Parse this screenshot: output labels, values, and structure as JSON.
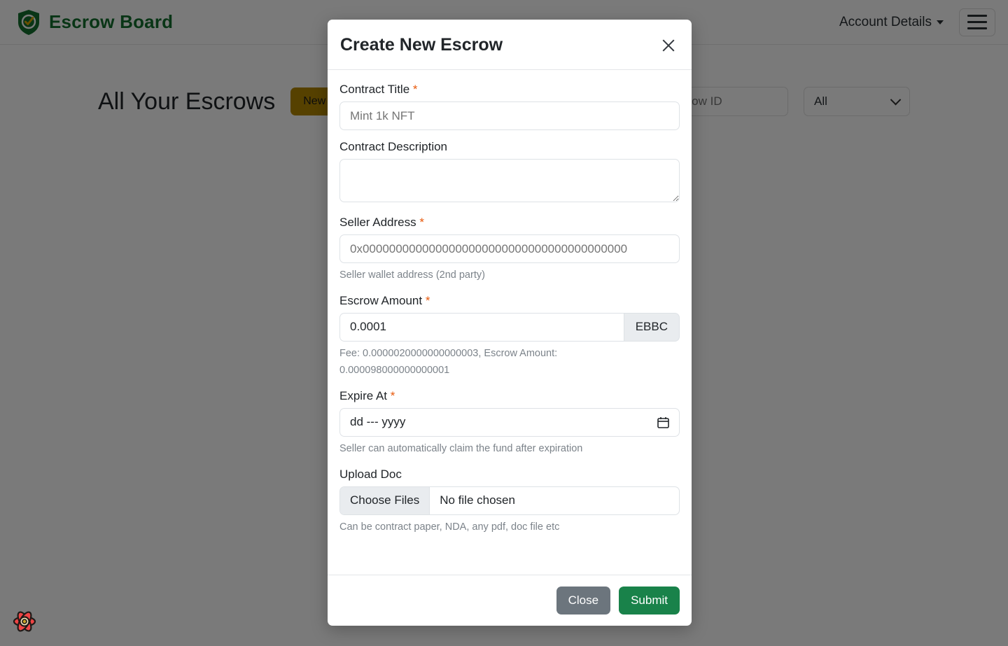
{
  "navbar": {
    "brand": "Escrow Board",
    "brand_icon": "shield-check-icon",
    "brand_color": "#14702f",
    "account_label": "Account Details",
    "menu_icon": "hamburger-menu-icon"
  },
  "toolbar": {
    "page_title": "All Your Escrows",
    "new_escrow_label": "New Escrow",
    "new_escrow_color": "#b58900",
    "search_placeholder": "Search By Escrow ID",
    "filter_value": "All",
    "filter_icon": "chevron-down-icon"
  },
  "modal": {
    "title": "Create New Escrow",
    "close_icon": "close-icon",
    "fields": {
      "contract_title": {
        "label": "Contract Title",
        "required_mark": "*",
        "placeholder": "Mint 1k NFT",
        "value": ""
      },
      "contract_description": {
        "label": "Contract Description",
        "placeholder": "",
        "value": ""
      },
      "seller_address": {
        "label": "Seller Address",
        "required_mark": "*",
        "placeholder": "0x0000000000000000000000000000000000000000",
        "value": "",
        "help": "Seller wallet address (2nd party)"
      },
      "escrow_amount": {
        "label": "Escrow Amount",
        "required_mark": "*",
        "value": "0.0001",
        "currency": "EBBC",
        "help_line1": "Fee: 0.0000020000000000003, Escrow Amount:",
        "help_line2": "0.000098000000000001"
      },
      "expire_at": {
        "label": "Expire At",
        "required_mark": "*",
        "value": "dd --- yyyy",
        "calendar_icon": "calendar-icon",
        "help": "Seller can automatically claim the fund after expiration"
      },
      "upload_doc": {
        "label": "Upload Doc",
        "choose_button": "Choose Files",
        "file_status": "No file chosen",
        "help": "Can be contract paper, NDA, any pdf, doc file etc"
      }
    },
    "footer": {
      "close_label": "Close",
      "submit_label": "Submit",
      "close_color": "#6c757d",
      "submit_color": "#19824a"
    }
  },
  "devtools": {
    "icon": "react-query-devtools-icon"
  }
}
